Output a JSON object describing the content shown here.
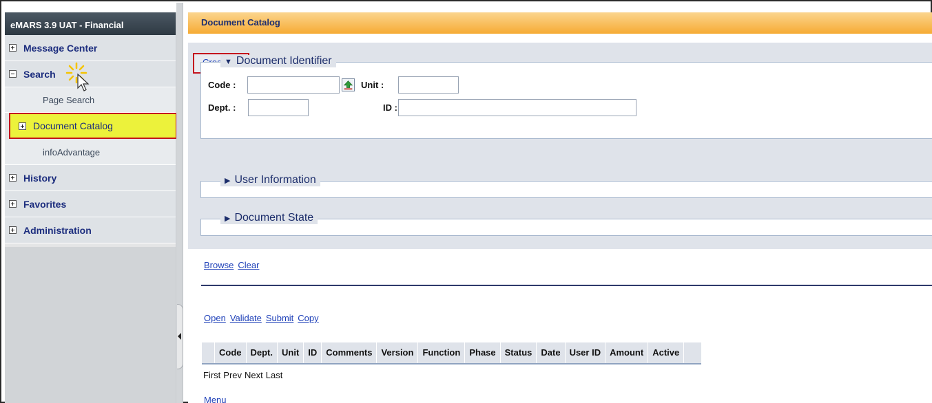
{
  "sidebar": {
    "app_title": "eMARS 3.9 UAT - Financial",
    "message_center": "Message Center",
    "search": "Search",
    "page_search": "Page Search",
    "document_catalog": "Document Catalog",
    "info_advantage": "infoAdvantage",
    "history": "History",
    "favorites": "Favorites",
    "administration": "Administration"
  },
  "page": {
    "title": "Document Catalog",
    "create": "Create"
  },
  "document_identifier": {
    "legend": "Document Identifier",
    "code_label": "Code :",
    "code_value": "",
    "unit_label": "Unit :",
    "unit_value": "",
    "dept_label": "Dept. :",
    "dept_value": "",
    "id_label": "ID :",
    "id_value": ""
  },
  "user_information": {
    "legend": "User Information"
  },
  "document_state": {
    "legend": "Document State"
  },
  "links": {
    "browse": "Browse",
    "clear": "Clear",
    "open": "Open",
    "validate": "Validate",
    "submit": "Submit",
    "copy": "Copy",
    "menu": "Menu"
  },
  "results": {
    "columns": [
      "Code",
      "Dept.",
      "Unit",
      "ID",
      "Comments",
      "Version",
      "Function",
      "Phase",
      "Status",
      "Date",
      "User ID",
      "Amount",
      "Active"
    ]
  },
  "pager": {
    "first": "First",
    "prev": "Prev",
    "next": "Next",
    "last": "Last"
  },
  "icons": {
    "expand": "expand-plus-icon",
    "collapse": "collapse-minus-icon",
    "lookup": "lookup-arrow-icon",
    "tool": "page-tools-icon",
    "cursor": "mouse-pointer-icon"
  },
  "colors": {
    "header_orange": "#f6ab34",
    "nav_text": "#1c2d7e",
    "highlight_yellow": "#ecf23b",
    "highlight_border": "#c4121d",
    "link_blue": "#1d3fb8"
  }
}
